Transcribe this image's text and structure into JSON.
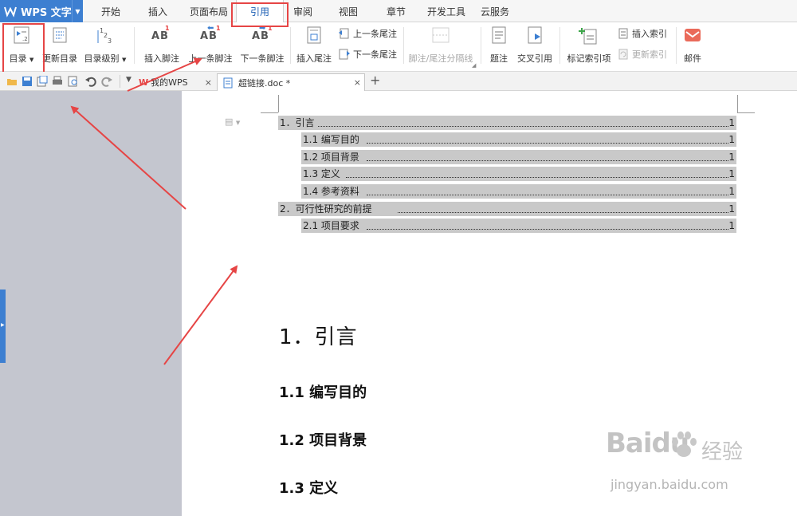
{
  "app": {
    "title": "WPS 文字",
    "brand_color": "#3d7fd1"
  },
  "menu_tabs": [
    {
      "label": "开始"
    },
    {
      "label": "插入"
    },
    {
      "label": "页面布局"
    },
    {
      "label": "引用",
      "active": true
    },
    {
      "label": "审阅"
    },
    {
      "label": "视图"
    },
    {
      "label": "章节"
    },
    {
      "label": "开发工具"
    },
    {
      "label": "云服务"
    }
  ],
  "ribbon": {
    "toc_label": "目录",
    "update_toc_label": "更新目录",
    "toc_level_label": "目录级别",
    "insert_footnote_label": "插入脚注",
    "prev_footnote_label": "上一条脚注",
    "next_footnote_label": "下一条脚注",
    "insert_endnote_label": "插入尾注",
    "prev_endnote_label": "上一条尾注",
    "next_endnote_label": "下一条尾注",
    "separator_label": "脚注/尾注分隔线",
    "caption_label": "题注",
    "cross_ref_label": "交叉引用",
    "mark_index_label": "标记索引项",
    "insert_index_label": "插入索引",
    "update_index_label": "更新索引",
    "mail_label": "邮件"
  },
  "doc_tabs": [
    {
      "label": "我的WPS"
    },
    {
      "label": "超链接.doc *",
      "active": true
    }
  ],
  "toc_entries": [
    {
      "text": "1．引言",
      "page": "1",
      "level": 1
    },
    {
      "text": "1.1  编写目的",
      "page": "1",
      "level": 2
    },
    {
      "text": "1.2  项目背景",
      "page": "1",
      "level": 2
    },
    {
      "text": "1.3  定义",
      "page": "1",
      "level": 2
    },
    {
      "text": "1.4  参考资料",
      "page": "1",
      "level": 2
    },
    {
      "text": "2．可行性研究的前提",
      "page": "1",
      "level": 1
    },
    {
      "text": "2.1  项目要求",
      "page": "1",
      "level": 2
    }
  ],
  "body": {
    "heading1": "1．引言",
    "heading_11": "1.1 编写目的",
    "heading_12": "1.2 项目背景",
    "heading_13": "1.3 定义"
  },
  "watermark": {
    "brand": "Baidu",
    "brand_cn": "经验",
    "url": "jingyan.baidu.com"
  },
  "annotation_color": "#e64545"
}
